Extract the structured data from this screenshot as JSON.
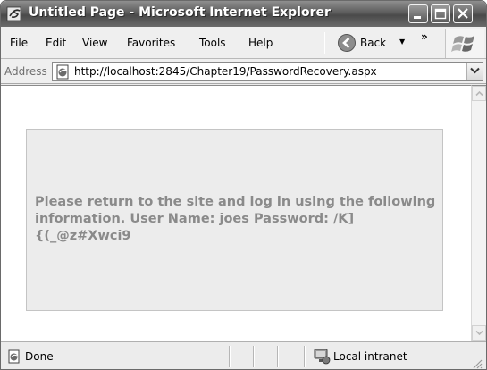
{
  "window": {
    "title": "Untitled Page - Microsoft Internet Explorer"
  },
  "menu": {
    "items": [
      "File",
      "Edit",
      "View",
      "Favorites",
      "Tools",
      "Help"
    ],
    "back_label": "Back",
    "more_chevron": "»"
  },
  "address": {
    "label": "Address",
    "url": "http://localhost:2845/Chapter19/PasswordRecovery.aspx"
  },
  "content": {
    "message": "Please return to the site and log in using the following information. User Name: joes Password: /K]{(_@z#Xwci9"
  },
  "status": {
    "text": "Done",
    "zone": "Local intranet"
  },
  "icons": {
    "title": "ie-logo-icon",
    "back": "back-arrow-icon",
    "page": "page-icon",
    "zone": "local-intranet-icon",
    "brand": "windows-flag-icon"
  }
}
